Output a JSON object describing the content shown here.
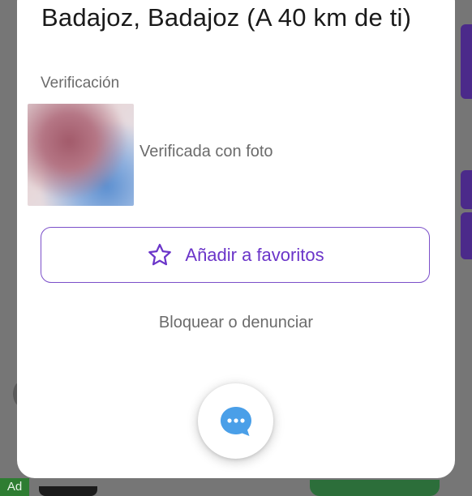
{
  "profile": {
    "location": "Badajoz, Badajoz (A 40 km de ti)",
    "verification_label": "Verificación",
    "verification_status": "Verificada con foto"
  },
  "actions": {
    "favorite_label": "Añadir a favoritos",
    "block_report_label": "Bloquear o denunciar"
  },
  "background": {
    "ad_badge": "Ad"
  },
  "icons": {
    "favorite": "star-outline-icon",
    "chat": "chat-bubble-icon"
  },
  "colors": {
    "accent_purple": "#6b35c9",
    "chat_blue": "#4a9fe8",
    "overlay": "#767676"
  }
}
